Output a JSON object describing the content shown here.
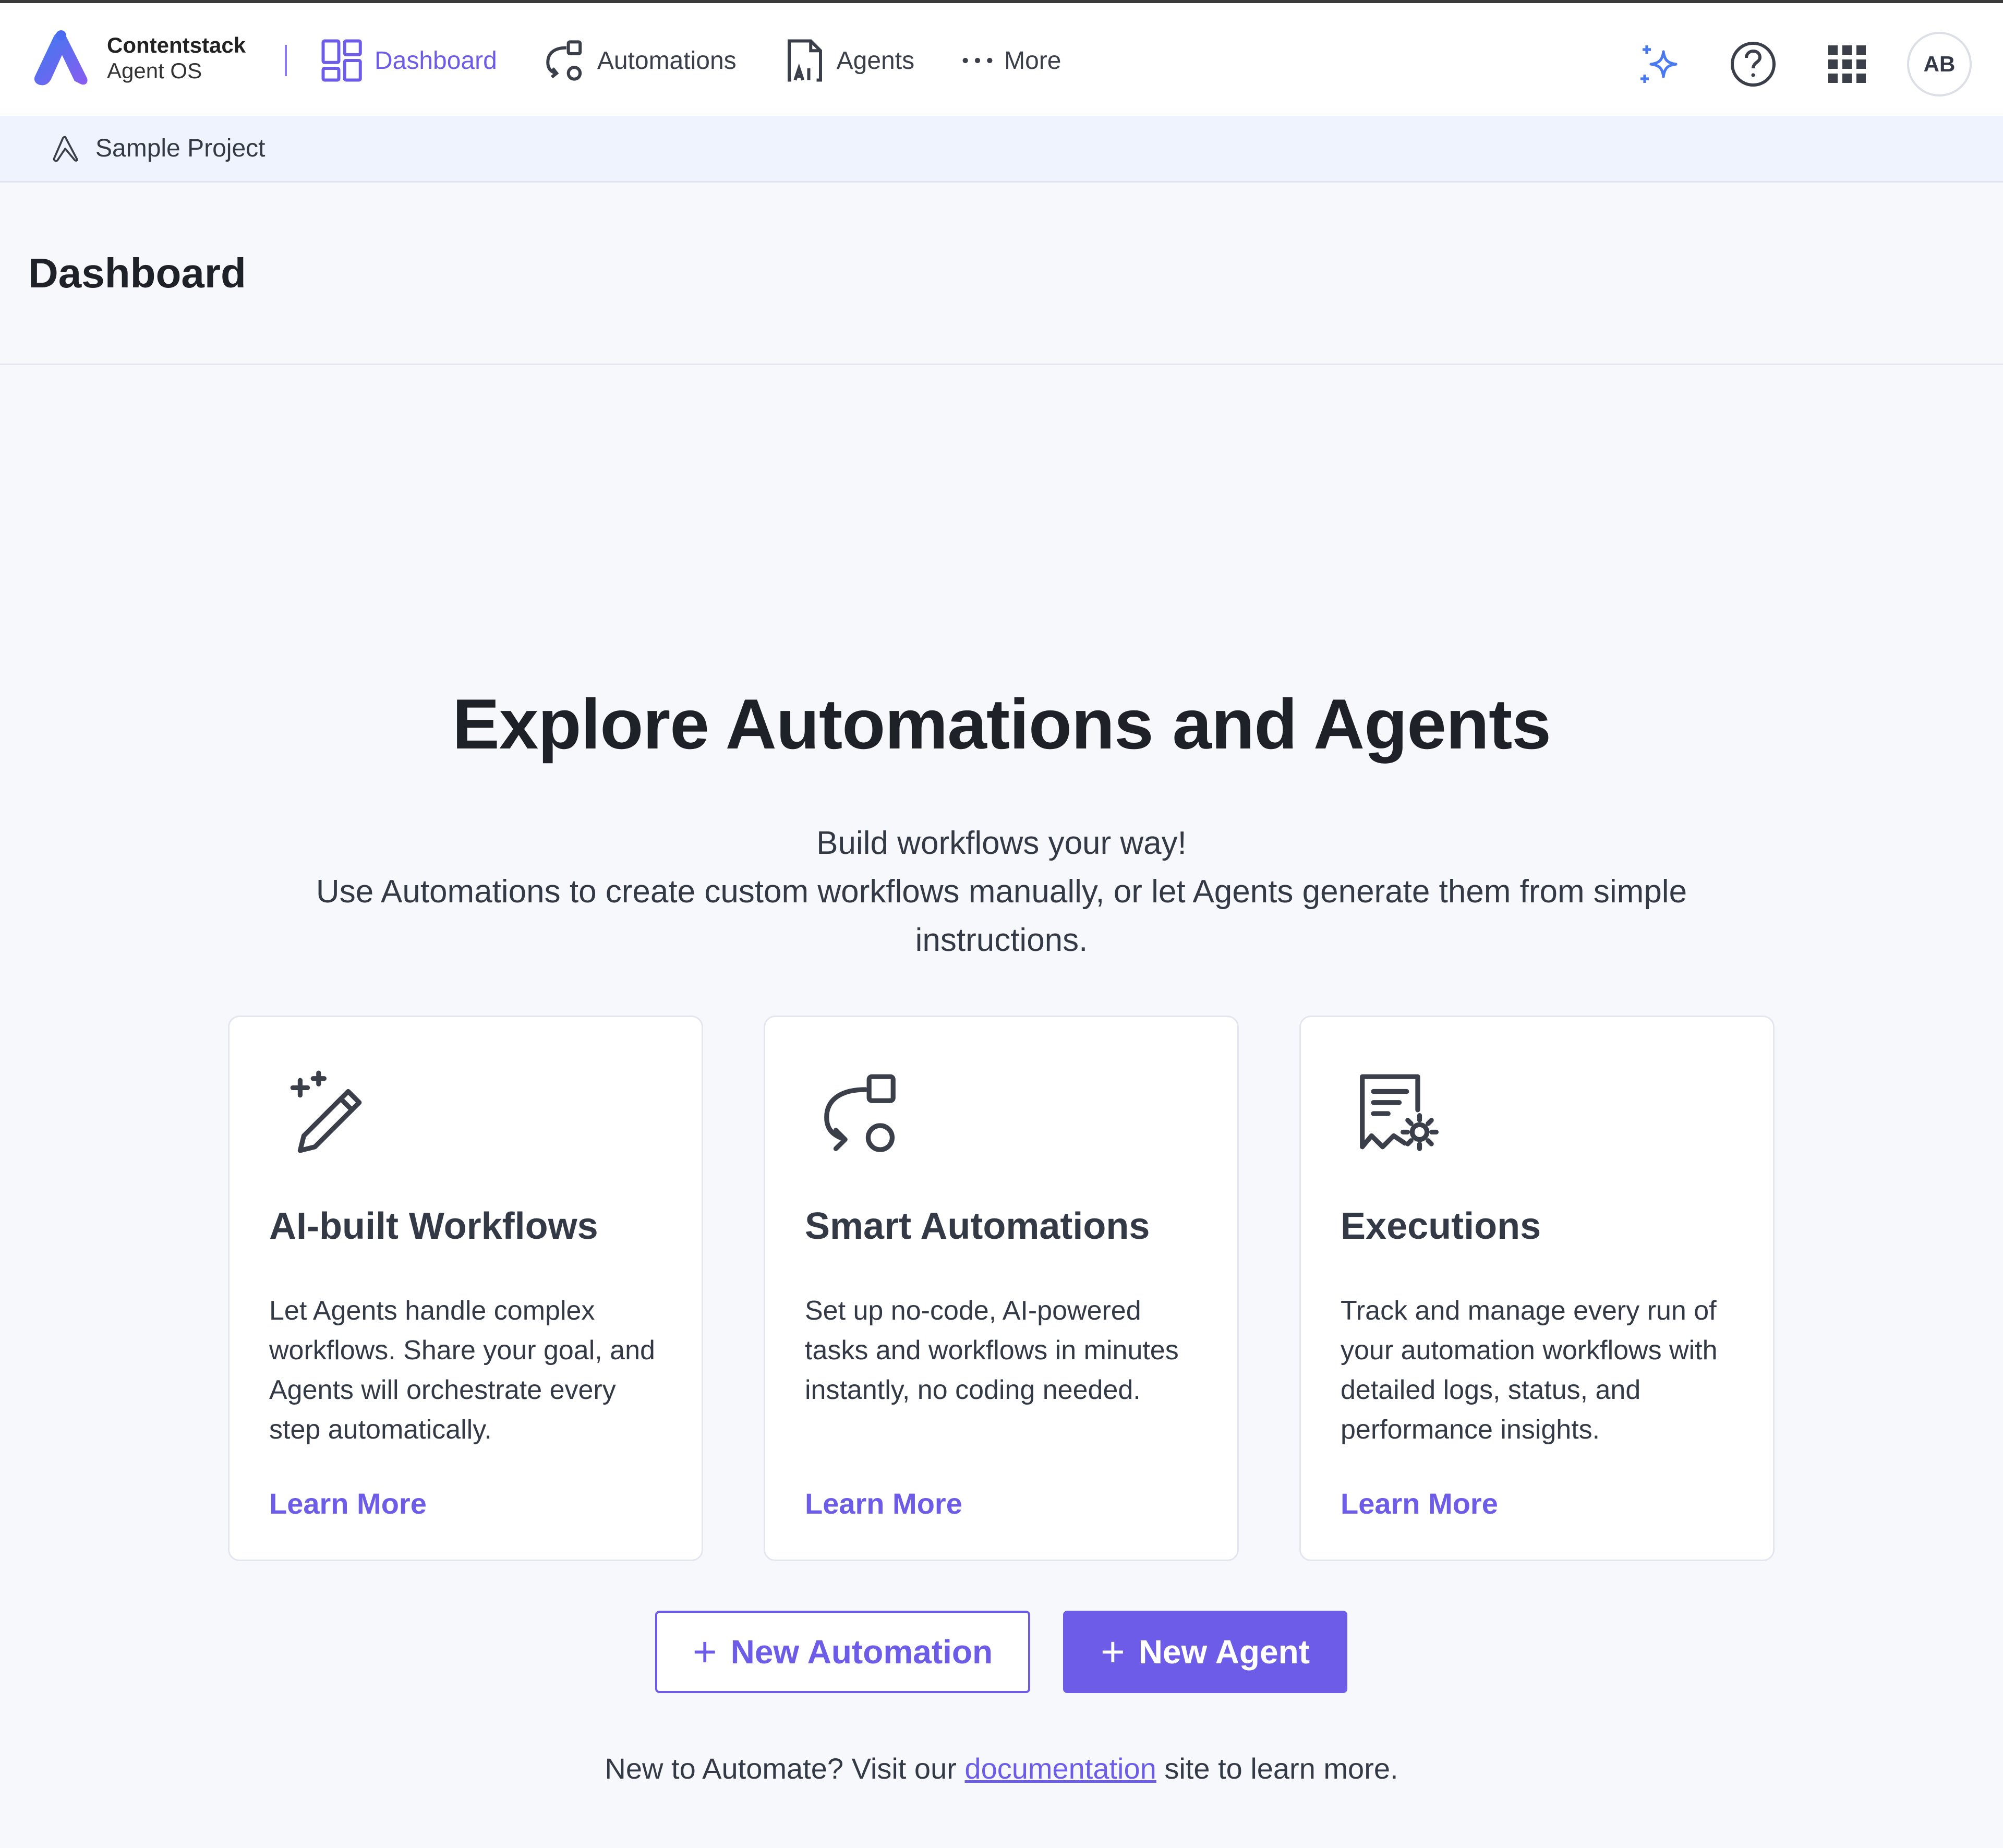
{
  "brand": {
    "name": "Contentstack",
    "product": "Agent OS"
  },
  "nav": {
    "items": [
      {
        "label": "Dashboard",
        "icon": "dashboard-icon",
        "active": true
      },
      {
        "label": "Automations",
        "icon": "automations-icon",
        "active": false
      },
      {
        "label": "Agents",
        "icon": "agents-icon",
        "active": false
      },
      {
        "label": "More",
        "icon": "more-dots-icon",
        "active": false
      }
    ]
  },
  "header_actions": {
    "avatar_initials": "AB",
    "icons": [
      "sparkle-icon",
      "help-icon",
      "app-grid-icon"
    ]
  },
  "breadcrumb": {
    "project": "Sample Project"
  },
  "page": {
    "title": "Dashboard"
  },
  "hero": {
    "title": "Explore Automations and Agents",
    "line1": "Build workflows your way!",
    "line2": "Use Automations to create custom workflows manually, or let Agents generate them from simple",
    "line3": "instructions."
  },
  "cards": [
    {
      "icon": "magic-pen-icon",
      "title": "AI-built Workflows",
      "description": "Let Agents handle complex workflows. Share your goal, and Agents will orchestrate every step automatically.",
      "link": "Learn More"
    },
    {
      "icon": "automation-flow-icon",
      "title": "Smart Automations",
      "description": "Set up no-code, AI-powered tasks and workflows in minutes instantly, no coding needed.",
      "link": "Learn More"
    },
    {
      "icon": "executions-log-icon",
      "title": "Executions",
      "description": "Track and manage every run of your automation workflows with detailed logs, status, and performance insights.",
      "link": "Learn More"
    }
  ],
  "buttons": {
    "new_automation": "New Automation",
    "new_agent": "New Agent",
    "plus": "+"
  },
  "footer": {
    "prefix": "New to Automate? Visit our",
    "link": "documentation",
    "suffix": "site to learn more."
  },
  "colors": {
    "accent": "#6c5ce7",
    "breadcrumb_bg": "#eef3fd",
    "page_bg": "#f7f8fc"
  }
}
